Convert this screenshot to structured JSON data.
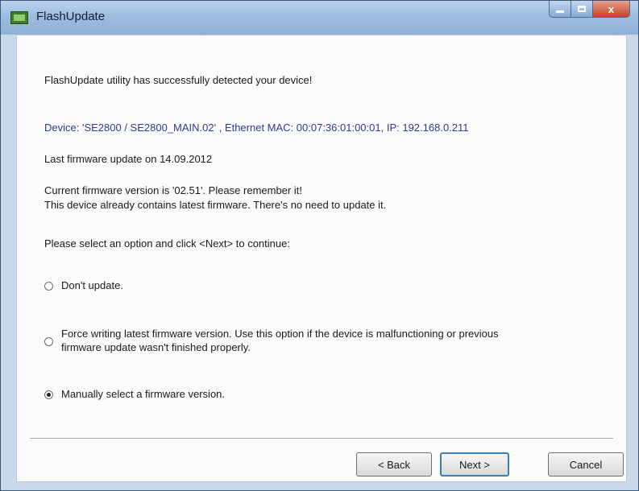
{
  "window": {
    "title": "FlashUpdate",
    "icon": "flashupdate-app-icon",
    "controls": [
      "minimize-icon",
      "maximize-icon",
      "close-icon"
    ],
    "close_glyph": "x"
  },
  "content": {
    "intro": "FlashUpdate utility has successfully detected your device!",
    "device_info": "Device: 'SE2800 / SE2800_MAIN.02' , Ethernet MAC: 00:07:36:01:00:01, IP: 192.168.0.211",
    "last_update": "Last firmware update on 14.09.2012",
    "current_version": "Current firmware version is '02.51'. Please remember it!",
    "latest_notice": "This device already contains latest firmware. There's no need to update it.",
    "prompt": "Please select an option and click <Next> to continue:"
  },
  "options": [
    {
      "label": "Don't update.",
      "checked": false
    },
    {
      "label_line1": "Force writing latest firmware version. Use this option if the device is malfunctioning or previous",
      "label_line2": "firmware update wasn't finished properly.",
      "checked": false
    },
    {
      "label": "Manually select a firmware version.",
      "checked": true
    }
  ],
  "buttons": {
    "back": "< Back",
    "next": "Next >",
    "cancel": "Cancel"
  },
  "colors": {
    "device_text": "#2b3b8f",
    "close_button": "#c4442a"
  }
}
